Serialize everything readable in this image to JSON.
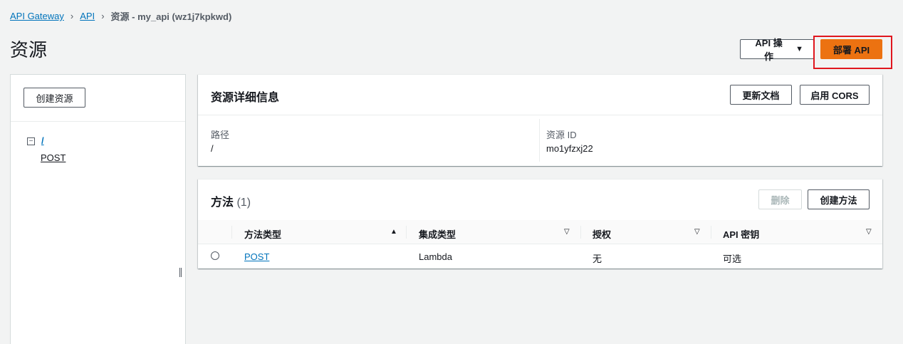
{
  "breadcrumb": {
    "items": [
      "API Gateway",
      "API"
    ],
    "current": "资源 - my_api (wz1j7kpkwd)"
  },
  "page": {
    "title": "资源",
    "actions_label": "API 操作",
    "deploy_label": "部署 API"
  },
  "left_panel": {
    "create_resource_label": "创建资源",
    "tree": {
      "root": "/",
      "children": [
        "POST"
      ]
    }
  },
  "details": {
    "title": "资源详细信息",
    "update_doc_label": "更新文档",
    "enable_cors_label": "启用 CORS",
    "path_label": "路径",
    "path_value": "/",
    "resource_id_label": "资源 ID",
    "resource_id_value": "mo1yfzxj22"
  },
  "methods": {
    "title": "方法",
    "count": "(1)",
    "delete_label": "删除",
    "create_label": "创建方法",
    "columns": [
      "方法类型",
      "集成类型",
      "授权",
      "API 密钥"
    ],
    "rows": [
      {
        "method": "POST",
        "integration": "Lambda",
        "auth": "无",
        "api_key": "可选"
      }
    ]
  },
  "colors": {
    "accent": "#ec7211",
    "link": "#0073bb",
    "highlight": "#e0161e"
  }
}
